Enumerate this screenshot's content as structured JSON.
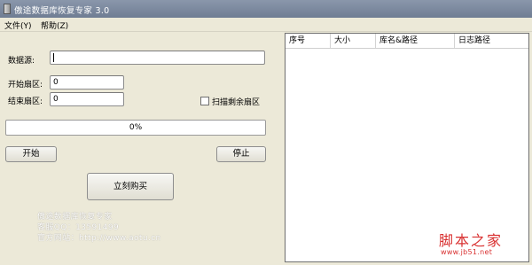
{
  "window": {
    "title": "傲途数据库恢复专家 3.0"
  },
  "menu": [
    {
      "label": "文件(Y)"
    },
    {
      "label": "帮助(Z)"
    }
  ],
  "form": {
    "source_label": "数据源:",
    "source_value": "",
    "start_sector_label": "开始扇区:",
    "start_sector_value": "0",
    "end_sector_label": "结束扇区:",
    "end_sector_value": "0",
    "scan_remaining_label": "扫描剩余扇区",
    "scan_remaining_checked": false
  },
  "progress": {
    "value": 0,
    "text": "0%"
  },
  "buttons": {
    "start": "开始",
    "stop": "停止",
    "buy": "立刻购买"
  },
  "info": {
    "line1": "傲途数据库恢复专家",
    "line2": "客服QQ：13591499",
    "line3": "官方网站：http://www.aotu.cn"
  },
  "table": {
    "columns": [
      "序号",
      "大小",
      "库名&路径",
      "日志路径"
    ],
    "rows": []
  },
  "site_watermark": {
    "logo": "脚本之家",
    "url": "www.jb51.net"
  },
  "colors": {
    "accent": "#3a8b3a",
    "titlebar": "#7b889e",
    "watermark": "#d93131"
  }
}
